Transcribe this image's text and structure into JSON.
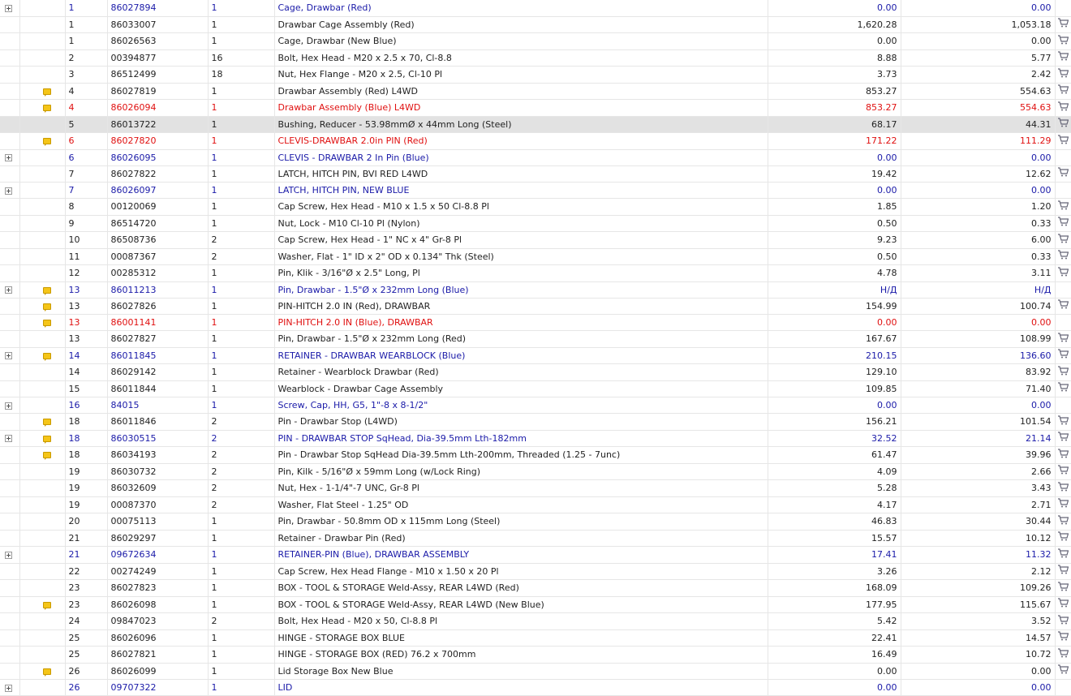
{
  "rows": [
    {
      "expand": true,
      "note": false,
      "style": "blue",
      "ref": "1",
      "part": "86027894",
      "qty": "1",
      "desc": "Cage, Drawbar (Red)",
      "price1": "0.00",
      "price2": "0.00",
      "cart": false
    },
    {
      "expand": false,
      "note": false,
      "style": "",
      "ref": "1",
      "part": "86033007",
      "qty": "1",
      "desc": "Drawbar Cage Assembly (Red)",
      "price1": "1,620.28",
      "price2": "1,053.18",
      "cart": true
    },
    {
      "expand": false,
      "note": false,
      "style": "",
      "ref": "1",
      "part": "86026563",
      "qty": "1",
      "desc": "Cage, Drawbar (New Blue)",
      "price1": "0.00",
      "price2": "0.00",
      "cart": true
    },
    {
      "expand": false,
      "note": false,
      "style": "",
      "ref": "2",
      "part": "00394877",
      "qty": "16",
      "desc": "Bolt, Hex Head - M20 x 2.5 x 70, Cl-8.8",
      "price1": "8.88",
      "price2": "5.77",
      "cart": true
    },
    {
      "expand": false,
      "note": false,
      "style": "",
      "ref": "3",
      "part": "86512499",
      "qty": "18",
      "desc": "Nut, Hex Flange - M20 x 2.5, Cl-10 Pl",
      "price1": "3.73",
      "price2": "2.42",
      "cart": true
    },
    {
      "expand": false,
      "note": true,
      "style": "",
      "ref": "4",
      "part": "86027819",
      "qty": "1",
      "desc": "Drawbar Assembly (Red) L4WD",
      "price1": "853.27",
      "price2": "554.63",
      "cart": true
    },
    {
      "expand": false,
      "note": true,
      "style": "red",
      "ref": "4",
      "part": "86026094",
      "qty": "1",
      "desc": "Drawbar Assembly (Blue) L4WD",
      "price1": "853.27",
      "price2": "554.63",
      "cart": true
    },
    {
      "expand": false,
      "note": false,
      "style": "hl",
      "ref": "5",
      "part": "86013722",
      "qty": "1",
      "desc": "Bushing, Reducer - 53.98mmØ x 44mm Long (Steel)",
      "price1": "68.17",
      "price2": "44.31",
      "cart": true
    },
    {
      "expand": false,
      "note": true,
      "style": "red",
      "ref": "6",
      "part": "86027820",
      "qty": "1",
      "desc": "CLEVIS-DRAWBAR 2.0in PIN (Red)",
      "price1": "171.22",
      "price2": "111.29",
      "cart": true
    },
    {
      "expand": true,
      "note": false,
      "style": "blue",
      "ref": "6",
      "part": "86026095",
      "qty": "1",
      "desc": "CLEVIS - DRAWBAR 2 In Pin (Blue)",
      "price1": "0.00",
      "price2": "0.00",
      "cart": false
    },
    {
      "expand": false,
      "note": false,
      "style": "",
      "ref": "7",
      "part": "86027822",
      "qty": "1",
      "desc": "LATCH, HITCH PIN, BVI RED L4WD",
      "price1": "19.42",
      "price2": "12.62",
      "cart": true
    },
    {
      "expand": true,
      "note": false,
      "style": "blue",
      "ref": "7",
      "part": "86026097",
      "qty": "1",
      "desc": "LATCH, HITCH PIN, NEW BLUE",
      "price1": "0.00",
      "price2": "0.00",
      "cart": false
    },
    {
      "expand": false,
      "note": false,
      "style": "",
      "ref": "8",
      "part": "00120069",
      "qty": "1",
      "desc": "Cap Screw, Hex Head - M10 x 1.5 x 50 Cl-8.8 Pl",
      "price1": "1.85",
      "price2": "1.20",
      "cart": true
    },
    {
      "expand": false,
      "note": false,
      "style": "",
      "ref": "9",
      "part": "86514720",
      "qty": "1",
      "desc": "Nut, Lock - M10 Cl-10 Pl (Nylon)",
      "price1": "0.50",
      "price2": "0.33",
      "cart": true
    },
    {
      "expand": false,
      "note": false,
      "style": "",
      "ref": "10",
      "part": "86508736",
      "qty": "2",
      "desc": "Cap Screw, Hex Head - 1\" NC x 4\" Gr-8 Pl",
      "price1": "9.23",
      "price2": "6.00",
      "cart": true
    },
    {
      "expand": false,
      "note": false,
      "style": "",
      "ref": "11",
      "part": "00087367",
      "qty": "2",
      "desc": "Washer, Flat - 1\" ID x 2\" OD x 0.134\" Thk (Steel)",
      "price1": "0.50",
      "price2": "0.33",
      "cart": true
    },
    {
      "expand": false,
      "note": false,
      "style": "",
      "ref": "12",
      "part": "00285312",
      "qty": "1",
      "desc": "Pin, Klik - 3/16\"Ø x 2.5\" Long, Pl",
      "price1": "4.78",
      "price2": "3.11",
      "cart": true
    },
    {
      "expand": true,
      "note": true,
      "style": "blue",
      "ref": "13",
      "part": "86011213",
      "qty": "1",
      "desc": "Pin, Drawbar - 1.5\"Ø x 232mm Long (Blue)",
      "price1": "Н/Д",
      "price2": "Н/Д",
      "cart": false
    },
    {
      "expand": false,
      "note": true,
      "style": "",
      "ref": "13",
      "part": "86027826",
      "qty": "1",
      "desc": "PIN-HITCH 2.0 IN (Red), DRAWBAR",
      "price1": "154.99",
      "price2": "100.74",
      "cart": true
    },
    {
      "expand": false,
      "note": true,
      "style": "red",
      "ref": "13",
      "part": "86001141",
      "qty": "1",
      "desc": "PIN-HITCH 2.0 IN (Blue), DRAWBAR",
      "price1": "0.00",
      "price2": "0.00",
      "cart": false
    },
    {
      "expand": false,
      "note": false,
      "style": "",
      "ref": "13",
      "part": "86027827",
      "qty": "1",
      "desc": "Pin, Drawbar - 1.5\"Ø x 232mm Long (Red)",
      "price1": "167.67",
      "price2": "108.99",
      "cart": true
    },
    {
      "expand": true,
      "note": true,
      "style": "blue",
      "ref": "14",
      "part": "86011845",
      "qty": "1",
      "desc": "RETAINER - DRAWBAR WEARBLOCK (Blue)",
      "price1": "210.15",
      "price2": "136.60",
      "cart": true
    },
    {
      "expand": false,
      "note": false,
      "style": "",
      "ref": "14",
      "part": "86029142",
      "qty": "1",
      "desc": "Retainer - Wearblock Drawbar (Red)",
      "price1": "129.10",
      "price2": "83.92",
      "cart": true
    },
    {
      "expand": false,
      "note": false,
      "style": "",
      "ref": "15",
      "part": "86011844",
      "qty": "1",
      "desc": "Wearblock - Drawbar Cage Assembly",
      "price1": "109.85",
      "price2": "71.40",
      "cart": true
    },
    {
      "expand": true,
      "note": false,
      "style": "blue",
      "ref": "16",
      "part": "84015",
      "qty": "1",
      "desc": "Screw, Cap, HH, G5, 1\"-8 x 8-1/2\"",
      "price1": "0.00",
      "price2": "0.00",
      "cart": false
    },
    {
      "expand": false,
      "note": true,
      "style": "",
      "ref": "18",
      "part": "86011846",
      "qty": "2",
      "desc": "Pin - Drawbar Stop (L4WD)",
      "price1": "156.21",
      "price2": "101.54",
      "cart": true
    },
    {
      "expand": true,
      "note": true,
      "style": "blue",
      "ref": "18",
      "part": "86030515",
      "qty": "2",
      "desc": "PIN - DRAWBAR STOP SqHead, Dia-39.5mm Lth-182mm",
      "price1": "32.52",
      "price2": "21.14",
      "cart": true
    },
    {
      "expand": false,
      "note": true,
      "style": "",
      "ref": "18",
      "part": "86034193",
      "qty": "2",
      "desc": "Pin - Drawbar Stop SqHead Dia-39.5mm Lth-200mm, Threaded (1.25 - 7unc)",
      "price1": "61.47",
      "price2": "39.96",
      "cart": true
    },
    {
      "expand": false,
      "note": false,
      "style": "",
      "ref": "19",
      "part": "86030732",
      "qty": "2",
      "desc": "Pin, Kilk - 5/16\"Ø x 59mm Long (w/Lock Ring)",
      "price1": "4.09",
      "price2": "2.66",
      "cart": true
    },
    {
      "expand": false,
      "note": false,
      "style": "",
      "ref": "19",
      "part": "86032609",
      "qty": "2",
      "desc": "Nut, Hex - 1-1/4\"-7 UNC, Gr-8 Pl",
      "price1": "5.28",
      "price2": "3.43",
      "cart": true
    },
    {
      "expand": false,
      "note": false,
      "style": "",
      "ref": "19",
      "part": "00087370",
      "qty": "2",
      "desc": "Washer, Flat Steel - 1.25\" OD",
      "price1": "4.17",
      "price2": "2.71",
      "cart": true
    },
    {
      "expand": false,
      "note": false,
      "style": "",
      "ref": "20",
      "part": "00075113",
      "qty": "1",
      "desc": "Pin, Drawbar - 50.8mm OD x 115mm Long (Steel)",
      "price1": "46.83",
      "price2": "30.44",
      "cart": true
    },
    {
      "expand": false,
      "note": false,
      "style": "",
      "ref": "21",
      "part": "86029297",
      "qty": "1",
      "desc": "Retainer - Drawbar Pin (Red)",
      "price1": "15.57",
      "price2": "10.12",
      "cart": true
    },
    {
      "expand": true,
      "note": false,
      "style": "blue",
      "ref": "21",
      "part": "09672634",
      "qty": "1",
      "desc": "RETAINER-PIN (Blue), DRAWBAR ASSEMBLY",
      "price1": "17.41",
      "price2": "11.32",
      "cart": true
    },
    {
      "expand": false,
      "note": false,
      "style": "",
      "ref": "22",
      "part": "00274249",
      "qty": "1",
      "desc": "Cap Screw, Hex Head Flange - M10 x 1.50 x 20 Pl",
      "price1": "3.26",
      "price2": "2.12",
      "cart": true
    },
    {
      "expand": false,
      "note": false,
      "style": "",
      "ref": "23",
      "part": "86027823",
      "qty": "1",
      "desc": "BOX - TOOL & STORAGE Weld-Assy, REAR L4WD (Red)",
      "price1": "168.09",
      "price2": "109.26",
      "cart": true
    },
    {
      "expand": false,
      "note": true,
      "style": "",
      "ref": "23",
      "part": "86026098",
      "qty": "1",
      "desc": "BOX - TOOL & STORAGE Weld-Assy, REAR L4WD (New Blue)",
      "price1": "177.95",
      "price2": "115.67",
      "cart": true
    },
    {
      "expand": false,
      "note": false,
      "style": "",
      "ref": "24",
      "part": "09847023",
      "qty": "2",
      "desc": "Bolt, Hex Head - M20 x 50, Cl-8.8 Pl",
      "price1": "5.42",
      "price2": "3.52",
      "cart": true
    },
    {
      "expand": false,
      "note": false,
      "style": "",
      "ref": "25",
      "part": "86026096",
      "qty": "1",
      "desc": "HINGE - STORAGE BOX BLUE",
      "price1": "22.41",
      "price2": "14.57",
      "cart": true
    },
    {
      "expand": false,
      "note": false,
      "style": "",
      "ref": "25",
      "part": "86027821",
      "qty": "1",
      "desc": "HINGE - STORAGE BOX (RED) 76.2 x 700mm",
      "price1": "16.49",
      "price2": "10.72",
      "cart": true
    },
    {
      "expand": false,
      "note": true,
      "style": "",
      "ref": "26",
      "part": "86026099",
      "qty": "1",
      "desc": "Lid Storage Box New Blue",
      "price1": "0.00",
      "price2": "0.00",
      "cart": true
    },
    {
      "expand": true,
      "note": false,
      "style": "blue",
      "ref": "26",
      "part": "09707322",
      "qty": "1",
      "desc": "LID",
      "price1": "0.00",
      "price2": "0.00",
      "cart": false
    }
  ],
  "icons": {
    "expand": "plus-square-icon",
    "note": "note-icon",
    "cart": "shopping-cart-icon"
  },
  "colors": {
    "blue": "#1a1aa8",
    "red": "#e01010",
    "highlight": "#e2e2e2",
    "note": "#f5c518"
  }
}
